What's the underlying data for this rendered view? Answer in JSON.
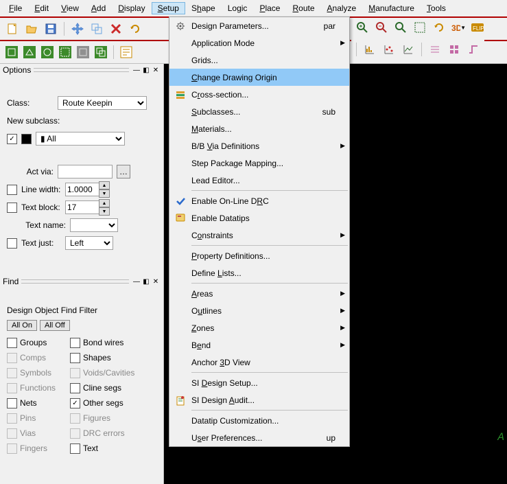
{
  "menu": {
    "items": [
      {
        "html": "<u>F</u>ile"
      },
      {
        "html": "<u>E</u>dit"
      },
      {
        "html": "<u>V</u>iew"
      },
      {
        "html": "<u>A</u>dd"
      },
      {
        "html": "<u>D</u>isplay"
      },
      {
        "html": "<u>S</u>etup"
      },
      {
        "html": "S<u>h</u>ape"
      },
      {
        "html": "Lo<u>g</u>ic"
      },
      {
        "html": "<u>P</u>lace"
      },
      {
        "html": "<u>R</u>oute"
      },
      {
        "html": "<u>A</u>nalyze"
      },
      {
        "html": "<u>M</u>anufacture"
      },
      {
        "html": "<u>T</u>ools"
      }
    ]
  },
  "setup_dropdown": [
    {
      "type": "item",
      "icon": "gear",
      "label_html": "Design Parameters...",
      "accel": "par"
    },
    {
      "type": "item",
      "label_html": "Application Mode",
      "sub": true
    },
    {
      "type": "item",
      "label_html": "Grids..."
    },
    {
      "type": "item",
      "label_html": "<u>C</u>hange Drawing Origin",
      "highlight": true
    },
    {
      "type": "item",
      "icon": "xsection",
      "label_html": "C<u>r</u>oss-section..."
    },
    {
      "type": "item",
      "label_html": "<u>S</u>ubclasses...",
      "accel": "sub"
    },
    {
      "type": "item",
      "label_html": "<u>M</u>aterials..."
    },
    {
      "type": "item",
      "label_html": "B/B <u>V</u>ia Definitions",
      "sub": true
    },
    {
      "type": "item",
      "label_html": "Step Package Mapping..."
    },
    {
      "type": "item",
      "label_html": "Lead Editor..."
    },
    {
      "type": "sep"
    },
    {
      "type": "item",
      "icon": "check",
      "label_html": "Enable On-Line D<u>R</u>C"
    },
    {
      "type": "item",
      "icon": "datatip",
      "label_html": "Enable Datatips"
    },
    {
      "type": "item",
      "label_html": "C<u>o</u>nstraints",
      "sub": true
    },
    {
      "type": "sep"
    },
    {
      "type": "item",
      "label_html": "<u>P</u>roperty Definitions..."
    },
    {
      "type": "item",
      "label_html": "Define <u>L</u>ists..."
    },
    {
      "type": "sep"
    },
    {
      "type": "item",
      "label_html": "<u>A</u>reas",
      "sub": true
    },
    {
      "type": "item",
      "label_html": "O<u>u</u>tlines",
      "sub": true
    },
    {
      "type": "item",
      "label_html": "<u>Z</u>ones",
      "sub": true
    },
    {
      "type": "item",
      "label_html": "B<u>e</u>nd",
      "sub": true
    },
    {
      "type": "item",
      "label_html": "Anchor <u>3</u>D View"
    },
    {
      "type": "sep"
    },
    {
      "type": "item",
      "label_html": "SI <u>D</u>esign Setup..."
    },
    {
      "type": "item",
      "icon": "audit",
      "label_html": "SI Design <u>A</u>udit..."
    },
    {
      "type": "sep"
    },
    {
      "type": "item",
      "label_html": "Datatip Customization..."
    },
    {
      "type": "item",
      "label_html": "U<u>s</u>er Preferences...",
      "accel": "up"
    }
  ],
  "options_panel": {
    "title": "Options",
    "class_label": "Class:",
    "class_value": "Route Keepin",
    "new_subclass_label": "New subclass:",
    "subclass_color_swatch": "#a06010",
    "subclass_value": "All",
    "act_via_label": "Act via:",
    "act_via_value": "",
    "line_width_label": "Line width:",
    "line_width_value": "1.0000",
    "text_block_label": "Text block:",
    "text_block_value": "17",
    "text_name_label": "Text name:",
    "text_name_value": "",
    "text_just_label": "Text just:",
    "text_just_value": "Left"
  },
  "find_panel": {
    "title": "Find",
    "filter_label": "Design Object Find Filter",
    "all_on": "All On",
    "all_off": "All Off",
    "left": [
      {
        "label": "Groups",
        "enabled": true,
        "checked": false
      },
      {
        "label": "Comps",
        "enabled": false,
        "checked": false
      },
      {
        "label": "Symbols",
        "enabled": false,
        "checked": false
      },
      {
        "label": "Functions",
        "enabled": false,
        "checked": false
      },
      {
        "label": "Nets",
        "enabled": true,
        "checked": false
      },
      {
        "label": "Pins",
        "enabled": false,
        "checked": false
      },
      {
        "label": "Vias",
        "enabled": false,
        "checked": false
      },
      {
        "label": "Fingers",
        "enabled": false,
        "checked": false
      }
    ],
    "right": [
      {
        "label": "Bond wires",
        "enabled": true,
        "checked": false
      },
      {
        "label": "Shapes",
        "enabled": true,
        "checked": false
      },
      {
        "label": "Voids/Cavities",
        "enabled": false,
        "checked": false
      },
      {
        "label": "Cline segs",
        "enabled": true,
        "checked": false
      },
      {
        "label": "Other segs",
        "enabled": true,
        "checked": true
      },
      {
        "label": "Figures",
        "enabled": false,
        "checked": false
      },
      {
        "label": "DRC errors",
        "enabled": false,
        "checked": false
      },
      {
        "label": "Text",
        "enabled": true,
        "checked": false
      }
    ]
  }
}
